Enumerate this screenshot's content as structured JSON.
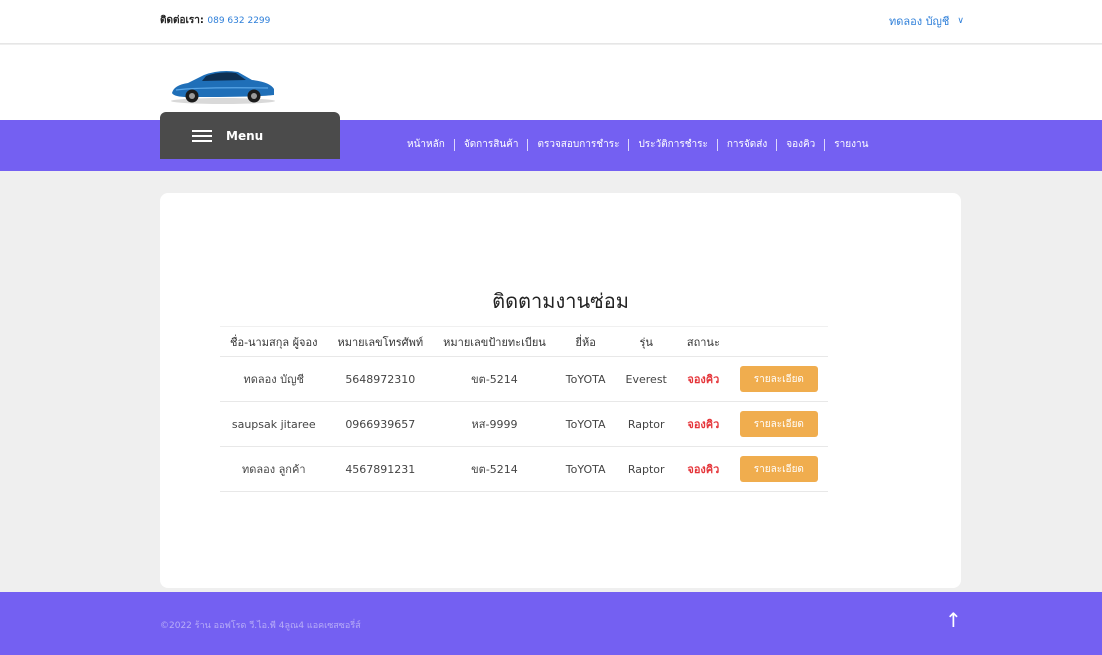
{
  "header": {
    "contact_label": "ติดต่อเรา:",
    "contact_phone": "089 632 2299",
    "account_name": "ทดลอง บัญชี",
    "account_chevron": "chevron-down-icon"
  },
  "logo": {
    "icon": "car-logo"
  },
  "nav": {
    "menu_label": "Menu",
    "items": [
      "หน้าหลัก",
      "จัดการสินค้า",
      "ตรวจสอบการชำระ",
      "ประวัติการชำระ",
      "การจัดส่ง",
      "จองคิว",
      "รายงาน"
    ]
  },
  "main": {
    "title": "ติดตามงานซ่อม",
    "columns": [
      "ชื่อ-นามสกุล ผู้จอง",
      "หมายเลขโทรศัพท์",
      "หมายเลขป้ายทะเบียน",
      "ยี่ห้อ",
      "รุ่น",
      "สถานะ",
      ""
    ],
    "rows": [
      {
        "name": "ทดลอง บัญชี",
        "phone": "5648972310",
        "plate": "ขต-5214",
        "brand": "ToYOTA",
        "model": "Everest",
        "status": "จองคิว",
        "action": "รายละเอียด"
      },
      {
        "name": "saupsak jitaree",
        "phone": "0966939657",
        "plate": "หส-9999",
        "brand": "ToYOTA",
        "model": "Raptor",
        "status": "จองคิว",
        "action": "รายละเอียด"
      },
      {
        "name": "ทดลอง ลูกค้า",
        "phone": "4567891231",
        "plate": "ขต-5214",
        "brand": "ToYOTA",
        "model": "Raptor",
        "status": "จองคิว",
        "action": "รายละเอียด"
      }
    ]
  },
  "footer": {
    "copyright": "©2022 ร้าน ออฟโรด วี.ไอ.พี 4ลูณ4 แอคเซสซอรี่ส์",
    "scroll_top_icon": "arrow-up-icon"
  },
  "colors": {
    "brand_purple": "#7460f2",
    "menu_dark": "#4b4b4b",
    "status_red": "#e5353a",
    "button_orange": "#f0ad4e",
    "link_blue": "#2e7fd9"
  }
}
